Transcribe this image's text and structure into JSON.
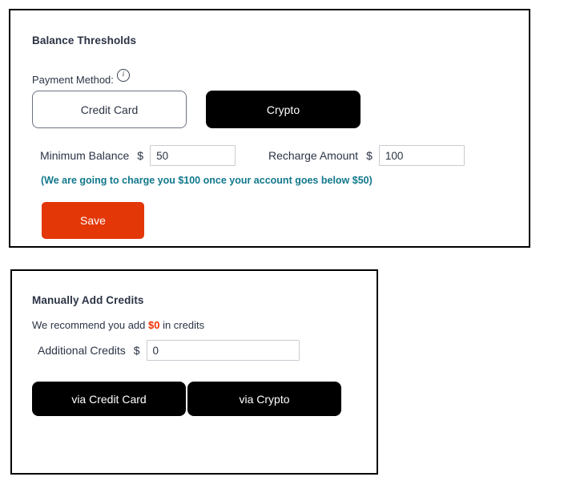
{
  "colors": {
    "accent_red": "#e33708",
    "note_teal": "#12788c",
    "recommend_red": "#f03000",
    "black": "#000000",
    "text": "#2b3445",
    "input_border": "#c9ccd2"
  },
  "thresholds_card": {
    "title": "Balance Thresholds",
    "payment_method": {
      "label": "Payment Method:",
      "info_icon": "info-icon",
      "info_glyph": "i",
      "options": [
        {
          "label": "Credit Card",
          "selected": false
        },
        {
          "label": "Crypto",
          "selected": true
        }
      ]
    },
    "minimum_balance": {
      "label": "Minimum Balance",
      "currency": "$",
      "value": "50",
      "placeholder": "50"
    },
    "recharge_amount": {
      "label": "Recharge Amount",
      "currency": "$",
      "value": "100",
      "placeholder": "100"
    },
    "note": "(We are going to charge you $100 once your account goes below $50)",
    "save_label": "Save"
  },
  "manual_card": {
    "title": "Manually Add Credits",
    "recommend_prefix": "We recommend you add ",
    "recommend_amount": "$0",
    "recommend_suffix": " in credits",
    "additional_credits": {
      "label": "Additional Credits",
      "currency": "$",
      "value": "0",
      "placeholder": "0"
    },
    "buttons": [
      {
        "label": "via Credit Card"
      },
      {
        "label": "via Crypto"
      }
    ]
  }
}
